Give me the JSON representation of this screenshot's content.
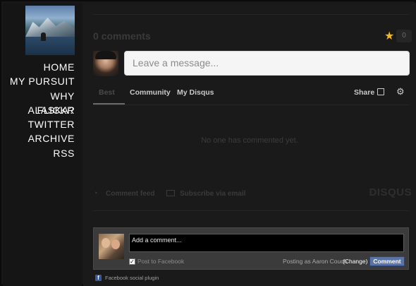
{
  "sidebar": {
    "nav": [
      "HOME",
      "MY PURSUIT",
      "WHY ALASKA?",
      "FLICKR",
      "TWITTER",
      "ARCHIVE",
      "RSS"
    ]
  },
  "disqus": {
    "comments_count": "0 comments",
    "favorite_count": "0",
    "message_placeholder": "Leave a message...",
    "tabs": [
      "Best",
      "Community",
      "My Disqus"
    ],
    "share_label": "Share",
    "empty_text": "No one has commented yet.",
    "comment_feed": "Comment feed",
    "subscribe_email": "Subscribe via email",
    "brand": "DISQUS"
  },
  "facebook": {
    "comment_placeholder": "Add a comment...",
    "post_to_facebook": "Post to Facebook",
    "posting_as": "Posting as Aaron Couch",
    "change": "(Change)",
    "comment_button": "Comment",
    "plugin_label": "Facebook social plugin",
    "logo_letter": "f"
  },
  "colors": {
    "background": "#1a1a1a",
    "star": "#f2b721",
    "facebook_button": "#5b74a8"
  }
}
